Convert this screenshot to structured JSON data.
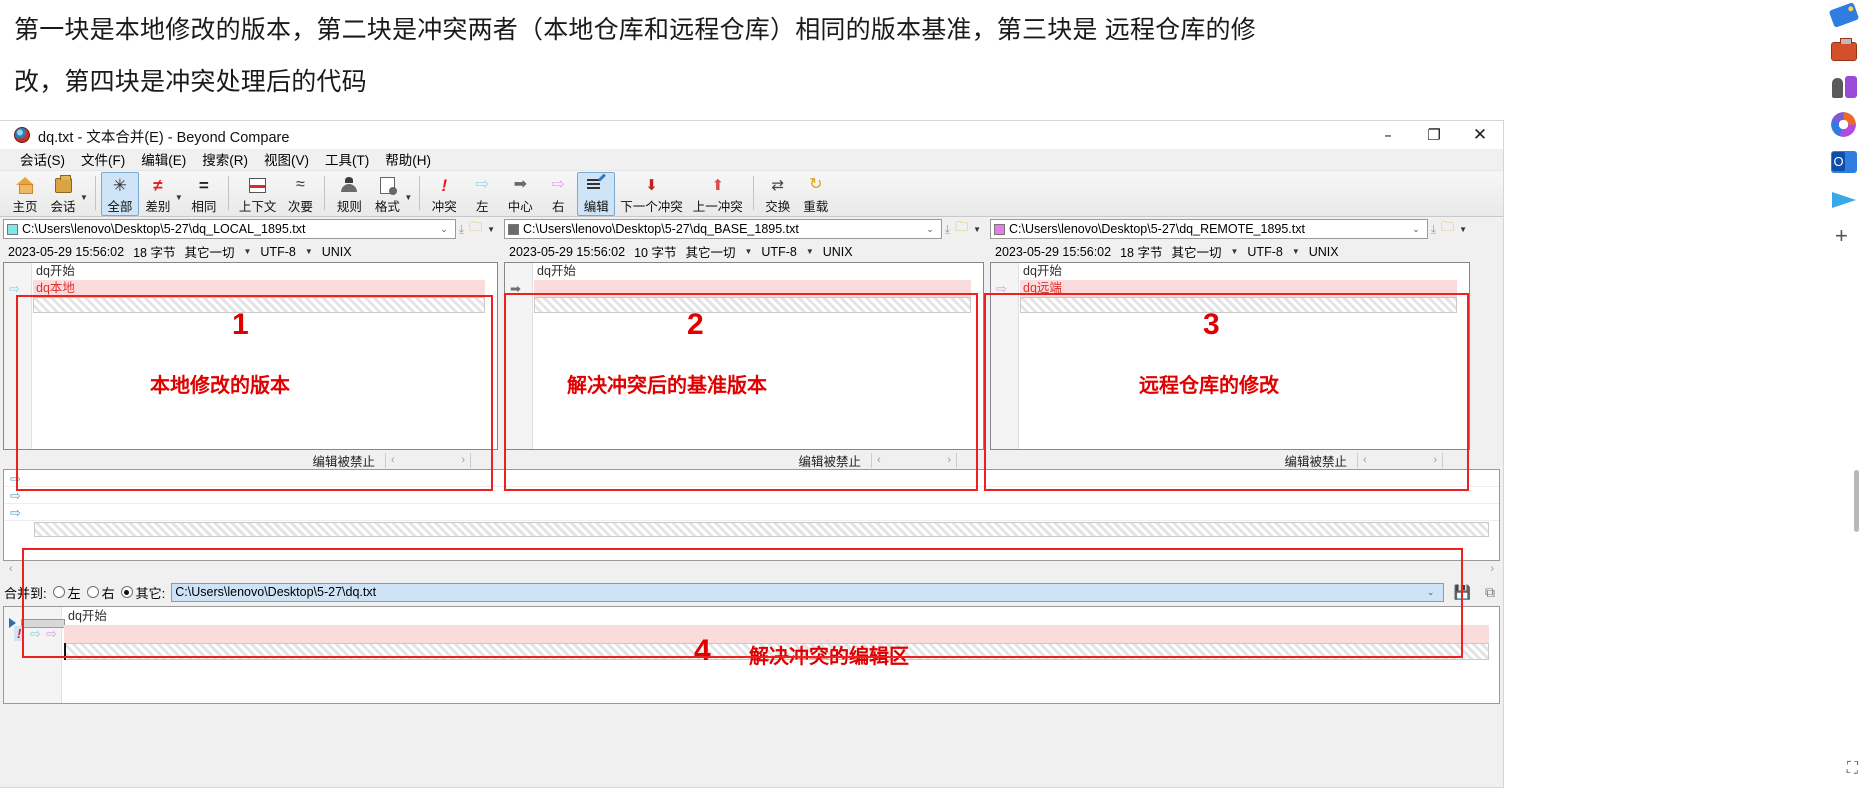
{
  "article": {
    "line1": "第一块是本地修改的版本，第二块是冲突两者（本地仓库和远程仓库）相同的版本基准，第三块是 远程仓库的修",
    "line2": "改，第四块是冲突处理后的代码"
  },
  "window": {
    "title": "dq.txt - 文本合并(E) - Beyond Compare",
    "app_icon": "beyond-compare-icon",
    "minimize": "–",
    "maximize": "❐",
    "close": "✕"
  },
  "menu": [
    {
      "label": "会话(S)"
    },
    {
      "label": "文件(F)"
    },
    {
      "label": "编辑(E)"
    },
    {
      "label": "搜索(R)"
    },
    {
      "label": "视图(V)"
    },
    {
      "label": "工具(T)"
    },
    {
      "label": "帮助(H)"
    }
  ],
  "toolbar": [
    {
      "label": "主页",
      "icon": "home-icon",
      "glyph": "",
      "selected": false,
      "dropdown": false
    },
    {
      "label": "会话",
      "icon": "briefcase-icon",
      "glyph": "",
      "selected": false,
      "dropdown": true
    },
    {
      "label": "全部",
      "icon": "asterisk-icon",
      "glyph": "✳",
      "selected": true,
      "dropdown": false
    },
    {
      "label": "差别",
      "icon": "not-equal-icon",
      "glyph": "≠",
      "selected": false,
      "dropdown": true
    },
    {
      "label": "相同",
      "icon": "equals-icon",
      "glyph": "=",
      "selected": false,
      "dropdown": false
    },
    {
      "label": "上下文",
      "icon": "context-icon",
      "glyph": "",
      "selected": false,
      "dropdown": false
    },
    {
      "label": "次要",
      "icon": "approx-equal-icon",
      "glyph": "≈",
      "selected": false,
      "dropdown": false
    },
    {
      "label": "规则",
      "icon": "rules-icon",
      "glyph": "",
      "selected": false,
      "dropdown": false
    },
    {
      "label": "格式",
      "icon": "format-icon",
      "glyph": "",
      "selected": false,
      "dropdown": true
    },
    {
      "label": "冲突",
      "icon": "exclamation-icon",
      "glyph": "❗",
      "selected": false,
      "dropdown": false
    },
    {
      "label": "左",
      "icon": "arrow-left-outline-icon",
      "glyph": "⇨",
      "selected": false,
      "dropdown": false
    },
    {
      "label": "中心",
      "icon": "arrow-center-icon",
      "glyph": "➡",
      "selected": false,
      "dropdown": false
    },
    {
      "label": "右",
      "icon": "arrow-right-pink-icon",
      "glyph": "⇨",
      "selected": false,
      "dropdown": false
    },
    {
      "label": "编辑",
      "icon": "edit-icon",
      "glyph": "",
      "selected": true,
      "dropdown": false
    },
    {
      "label": "下一个冲突",
      "icon": "arrow-down-icon",
      "glyph": "⬇",
      "selected": false,
      "dropdown": false
    },
    {
      "label": "上一冲突",
      "icon": "arrow-up-icon",
      "glyph": "⬆",
      "selected": false,
      "dropdown": false
    },
    {
      "label": "交换",
      "icon": "swap-icon",
      "glyph": "⇄",
      "selected": false,
      "dropdown": false
    },
    {
      "label": "重载",
      "icon": "reload-icon",
      "glyph": "↻",
      "selected": false,
      "dropdown": false
    }
  ],
  "panes": [
    {
      "id": "local",
      "swatch_color": "#7de8ea",
      "path": "C:\\Users\\lenovo\\Desktop\\5-27\\dq_LOCAL_1895.txt",
      "info": {
        "timestamp": "2023-05-29 15:56:02",
        "size": "18 字节",
        "rules": "其它一切",
        "encoding": "UTF-8",
        "eol": "UNIX"
      },
      "lines": [
        {
          "text": "dq开始",
          "kind": "same"
        },
        {
          "text": "dq本地",
          "kind": "changed",
          "marker": "⇨",
          "marker_color": "#7fd4e6"
        },
        {
          "text": "",
          "kind": "filler"
        }
      ],
      "badge_number": "1",
      "badge_caption": "本地修改的版本",
      "status": "编辑被禁止"
    },
    {
      "id": "base",
      "swatch_color": "#6b6b6b",
      "path": "C:\\Users\\lenovo\\Desktop\\5-27\\dq_BASE_1895.txt",
      "info": {
        "timestamp": "2023-05-29 15:56:02",
        "size": "10 字节",
        "rules": "其它一切",
        "encoding": "UTF-8",
        "eol": "UNIX"
      },
      "lines": [
        {
          "text": "dq开始",
          "kind": "same"
        },
        {
          "text": "",
          "kind": "changed",
          "marker": "➡",
          "marker_color": "#707070"
        },
        {
          "text": "",
          "kind": "filler"
        }
      ],
      "badge_number": "2",
      "badge_caption": "解决冲突后的基准版本",
      "status": "编辑被禁止"
    },
    {
      "id": "remote",
      "swatch_color": "#e77ce7",
      "path": "C:\\Users\\lenovo\\Desktop\\5-27\\dq_REMOTE_1895.txt",
      "info": {
        "timestamp": "2023-05-29 15:56:02",
        "size": "18 字节",
        "rules": "其它一切",
        "encoding": "UTF-8",
        "eol": "UNIX"
      },
      "lines": [
        {
          "text": "dq开始",
          "kind": "same"
        },
        {
          "text": "dq远端",
          "kind": "changed",
          "marker": "⇨",
          "marker_color": "#d9a0e6"
        },
        {
          "text": "",
          "kind": "filler"
        }
      ],
      "badge_number": "3",
      "badge_caption": "远程仓库的修改",
      "status": "编辑被禁止"
    }
  ],
  "merge_bar": {
    "label": "合并到:",
    "options": [
      {
        "label": "左",
        "selected": false
      },
      {
        "label": "右",
        "selected": false
      },
      {
        "label": "其它:",
        "selected": true
      }
    ],
    "path": "C:\\Users\\lenovo\\Desktop\\5-27\\dq.txt",
    "save_icon": "save-icon",
    "copy_icon": "copy-icon"
  },
  "output_pane": {
    "lines": [
      {
        "text": "dq开始",
        "kind": "same"
      },
      {
        "text": "",
        "kind": "conflict",
        "markers": [
          "❗",
          "⇨",
          "⇨"
        ]
      },
      {
        "text": "",
        "kind": "filler"
      }
    ],
    "badge_number": "4",
    "badge_caption": "解决冲突的编辑区"
  },
  "sidebar": {
    "icons": [
      {
        "name": "tag-icon"
      },
      {
        "name": "briefcase-icon"
      },
      {
        "name": "chess-icon"
      },
      {
        "name": "microsoft-365-icon"
      },
      {
        "name": "outlook-icon"
      },
      {
        "name": "telegram-icon"
      },
      {
        "name": "add-icon"
      }
    ],
    "note_icon": "screenshot-icon"
  },
  "colors": {
    "accent_red": "#ef2020",
    "conflict_bg": "#fbdcdc",
    "selected_toolbar": "#cfe5f7",
    "merge_path_bg": "#cfe3f7"
  }
}
